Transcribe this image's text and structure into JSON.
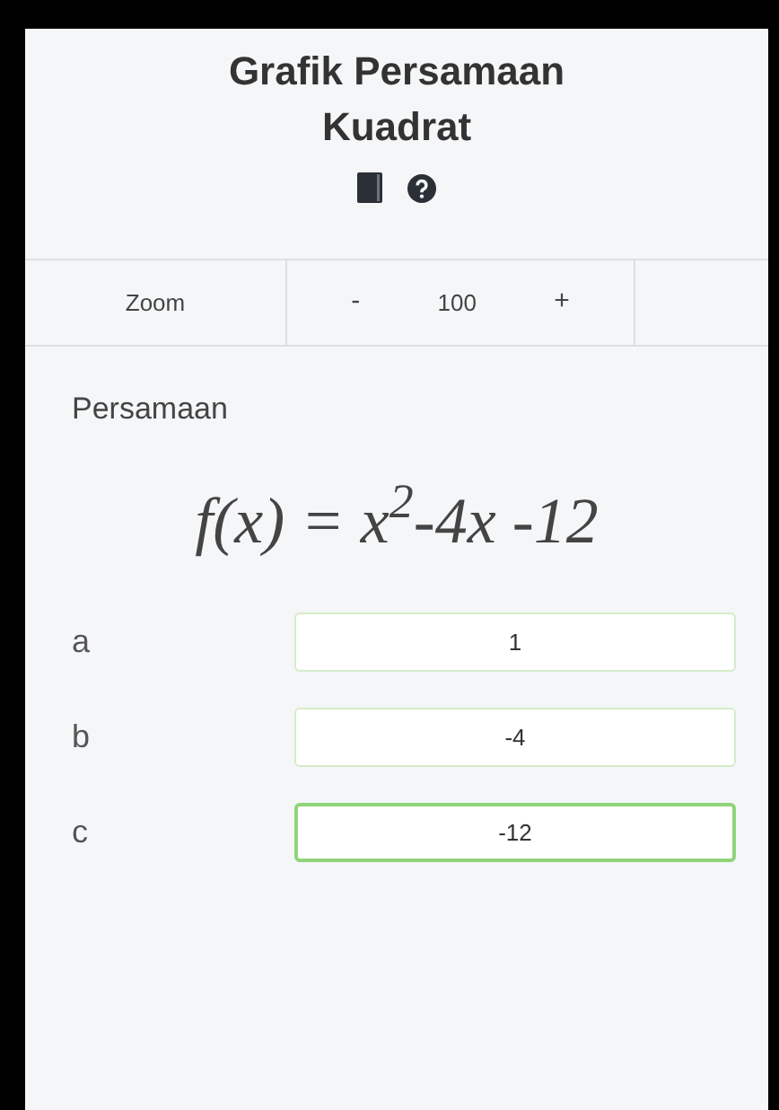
{
  "title": "Grafik Persamaan Kuadrat",
  "zoom": {
    "label": "Zoom",
    "decrease": "-",
    "value": "100",
    "increase": "+"
  },
  "section_title": "Persamaan",
  "formula": "f(x) = x$^{2}$-4x -12",
  "coefficients": [
    {
      "label": "a",
      "value": "1",
      "focused": false
    },
    {
      "label": "b",
      "value": "-4",
      "focused": false
    },
    {
      "label": "c",
      "value": "-12",
      "focused": true
    }
  ]
}
